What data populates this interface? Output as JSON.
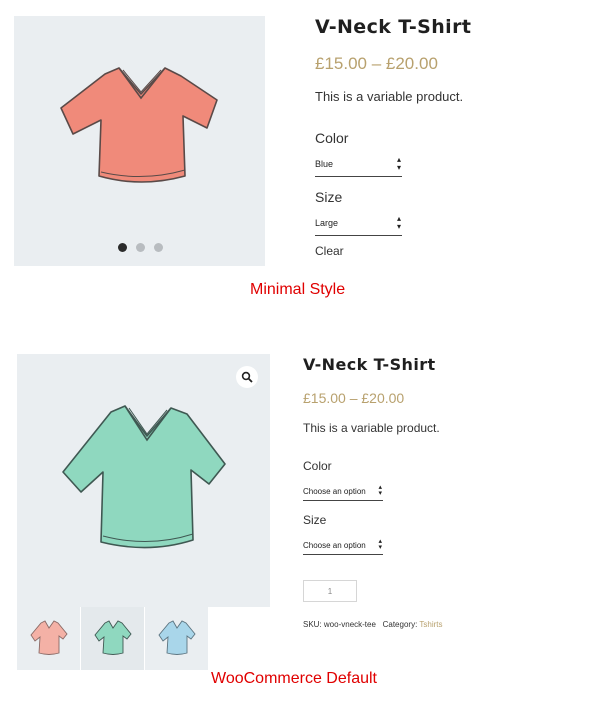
{
  "minimal": {
    "title": "V-Neck T-Shirt",
    "price": "£15.00 – £20.00",
    "description": "This is a variable product.",
    "color_label": "Color",
    "color_value": "Blue",
    "size_label": "Size",
    "size_value": "Large",
    "clear_label": "Clear",
    "caption": "Minimal Style",
    "image_icon": "tshirt-coral-illustration",
    "shirt_color": "#f08a7a",
    "gallery_dots": 3,
    "active_dot": 1
  },
  "woocommerce": {
    "title": "V-Neck T-Shirt",
    "price": "£15.00 – £20.00",
    "description": "This is a variable product.",
    "color_label": "Color",
    "color_placeholder": "Choose an option",
    "size_label": "Size",
    "size_placeholder": "Choose an option",
    "quantity": "1",
    "sku_label": "SKU:",
    "sku_value": "woo-vneck-tee",
    "category_label": "Category:",
    "category_value": "Tshirts",
    "caption": "WooCommerce Default",
    "zoom_icon": "magnifier-icon",
    "shirt_color": "#8fd8bf",
    "thumbnails": [
      {
        "name": "thumb-coral-shirt",
        "color": "#f4b1a6"
      },
      {
        "name": "thumb-mint-shirt",
        "color": "#8fd8bf"
      },
      {
        "name": "thumb-blue-shirt",
        "color": "#a9d6ea"
      }
    ]
  },
  "colors": {
    "price_gold": "#b8a16e",
    "caption_red": "#e00000",
    "image_bg": "#eaeef1"
  }
}
